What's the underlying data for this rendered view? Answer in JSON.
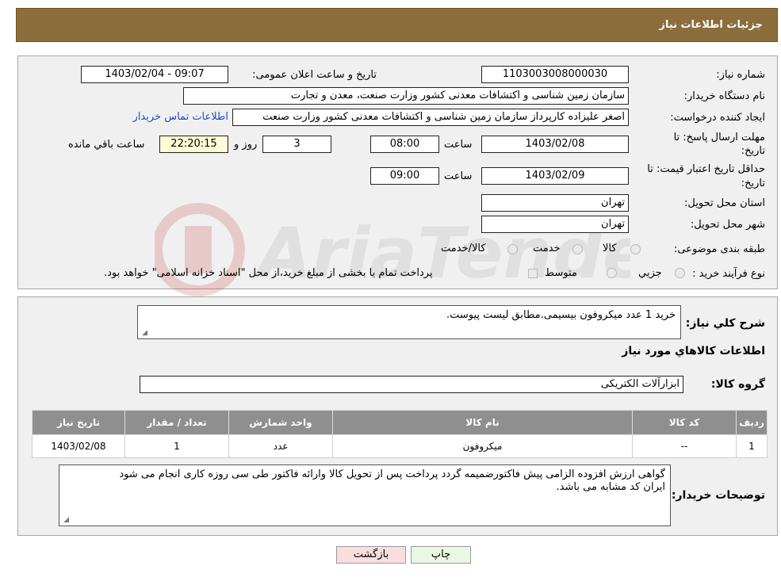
{
  "header": {
    "title": "جزئیات اطلاعات نیاز"
  },
  "form": {
    "need_number": {
      "label": "شماره نیاز:",
      "value": "1103003008000030"
    },
    "announce": {
      "label": "تاریخ و ساعت اعلان عمومی:",
      "value": "1403/02/04 - 09:07"
    },
    "buyer_org": {
      "label": "نام دستگاه خریدار:",
      "value": "سازمان زمین شناسی و اکتشافات معدنی کشور وزارت صنعت، معدن و تجارت"
    },
    "requester": {
      "label": "ایجاد کننده درخواست:",
      "value": "اصغر علیزاده کارپرداز سازمان زمین شناسی و اکتشافات معدنی کشور وزارت صنعت",
      "contact_link": "اطلاعات تماس خریدار"
    },
    "reply_deadline": {
      "label_line1": "مهلت ارسال پاسخ: تا",
      "label_line2": "تاریخ:",
      "date": "1403/02/08",
      "time_label": "ساعت",
      "time": "08:00",
      "days": "3",
      "days_label": "روز و",
      "remaining": "22:20:15",
      "remaining_label": "ساعت باقي مانده"
    },
    "price_validity": {
      "label_line1": "حداقل تاریخ اعتبار قیمت: تا",
      "label_line2": "تاریخ:",
      "date": "1403/02/09",
      "time_label": "ساعت",
      "time": "09:00"
    },
    "province": {
      "label": "استان محل تحویل:",
      "value": "تهران"
    },
    "city": {
      "label": "شهر محل تحویل:",
      "value": "تهران"
    },
    "category": {
      "label": "طبقه بندی موضوعی:",
      "options": [
        "کالا",
        "خدمت",
        "کالا/خدمت"
      ]
    },
    "purchase_type": {
      "label": "نوع فرآیند خرید :",
      "options": [
        "جزیي",
        "متوسط"
      ],
      "note": "پرداخت تمام یا بخشی از مبلغ خرید،از محل \"اسناد خزانه اسلامی\" خواهد بود."
    }
  },
  "description": {
    "label": "شرح كلي نياز:",
    "value": "خرید 1 عدد میکروفون بیسیمی.مطابق لیست پیوست."
  },
  "goods_section": {
    "title": "اطلاعات كالاهاي مورد نياز"
  },
  "goods_group": {
    "label": "گروه کالا:",
    "value": "ابزارآلات الکتریکی"
  },
  "table": {
    "headers": [
      "رديف",
      "كد كالا",
      "نام كالا",
      "واحد شمارش",
      "تعداد / مقدار",
      "تاريخ نياز"
    ],
    "rows": [
      [
        "1",
        "--",
        "میکروفون",
        "عدد",
        "1",
        "1403/02/08"
      ]
    ]
  },
  "buyer_notes": {
    "label": "توضیحات خریدار:",
    "line1": "گواهی ارزش افزوده الزامی پیش فاکتورضمیمه گردد پرداخت پس از تحویل کالا وارائه فاکتور طی سی روزه کاری انجام می شود",
    "line2": "ایران کد مشابه می باشد."
  },
  "buttons": {
    "print": "چاپ",
    "back": "بازگشت"
  },
  "colors": {
    "header": "#8c6d3c",
    "table_header": "#8f8f8f",
    "link": "#1a4fc9",
    "back_button": "#f9dede"
  }
}
